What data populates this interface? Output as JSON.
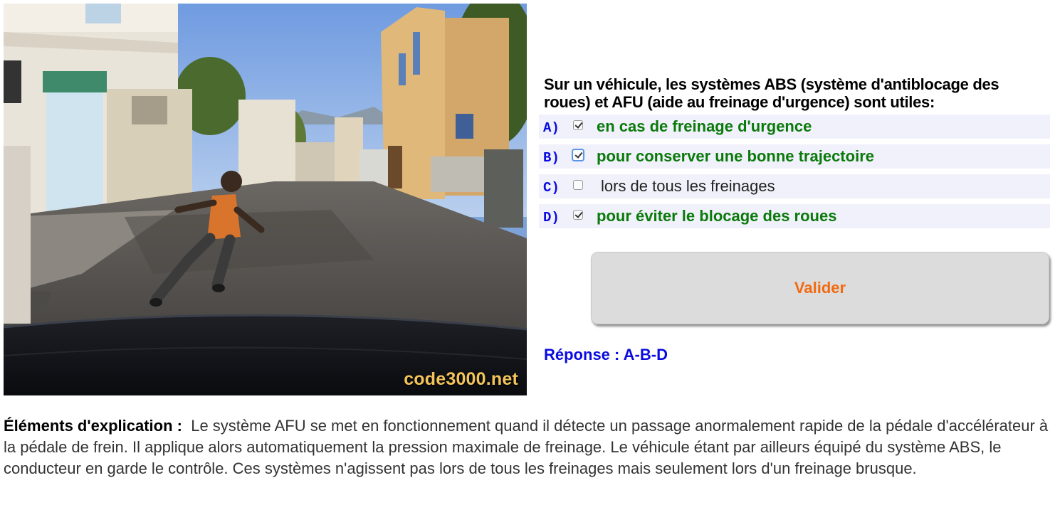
{
  "photo": {
    "watermark": "code3000.net",
    "description_icon": "street-scene-photo"
  },
  "question": {
    "text": "Sur un véhicule, les systèmes ABS (système d'antiblocage des roues) et AFU (aide au freinage d'urgence) sont utiles:"
  },
  "answers": [
    {
      "letter": "A)",
      "text": "en cas de freinage d'urgence",
      "checked": true,
      "correct": true
    },
    {
      "letter": "B)",
      "text": "pour conserver une bonne trajectoire",
      "checked": true,
      "correct": true
    },
    {
      "letter": "C)",
      "text": "lors de tous les freinages",
      "checked": false,
      "correct": false
    },
    {
      "letter": "D)",
      "text": "pour éviter le blocage des roues",
      "checked": true,
      "correct": true
    }
  ],
  "validate": {
    "label": "Valider"
  },
  "reponse": {
    "text": "Réponse : A-B-D"
  },
  "explanation": {
    "label": "Éléments d'explication :",
    "text": "Le système AFU se met en fonctionnement quand il détecte un passage anormalement rapide de la pédale d'accélérateur à la pédale de frein. Il applique alors automatiquement la pression maximale de freinage. Le véhicule étant par ailleurs équipé du système ABS, le conducteur en garde le contrôle. Ces systèmes n'agissent pas lors de tous les freinages mais seulement lors d'un freinage brusque."
  },
  "colors": {
    "correct": "#0a7a0a",
    "letter": "#0b0be0",
    "button_text": "#f26a10",
    "row_bg": "#f1f1fb"
  }
}
